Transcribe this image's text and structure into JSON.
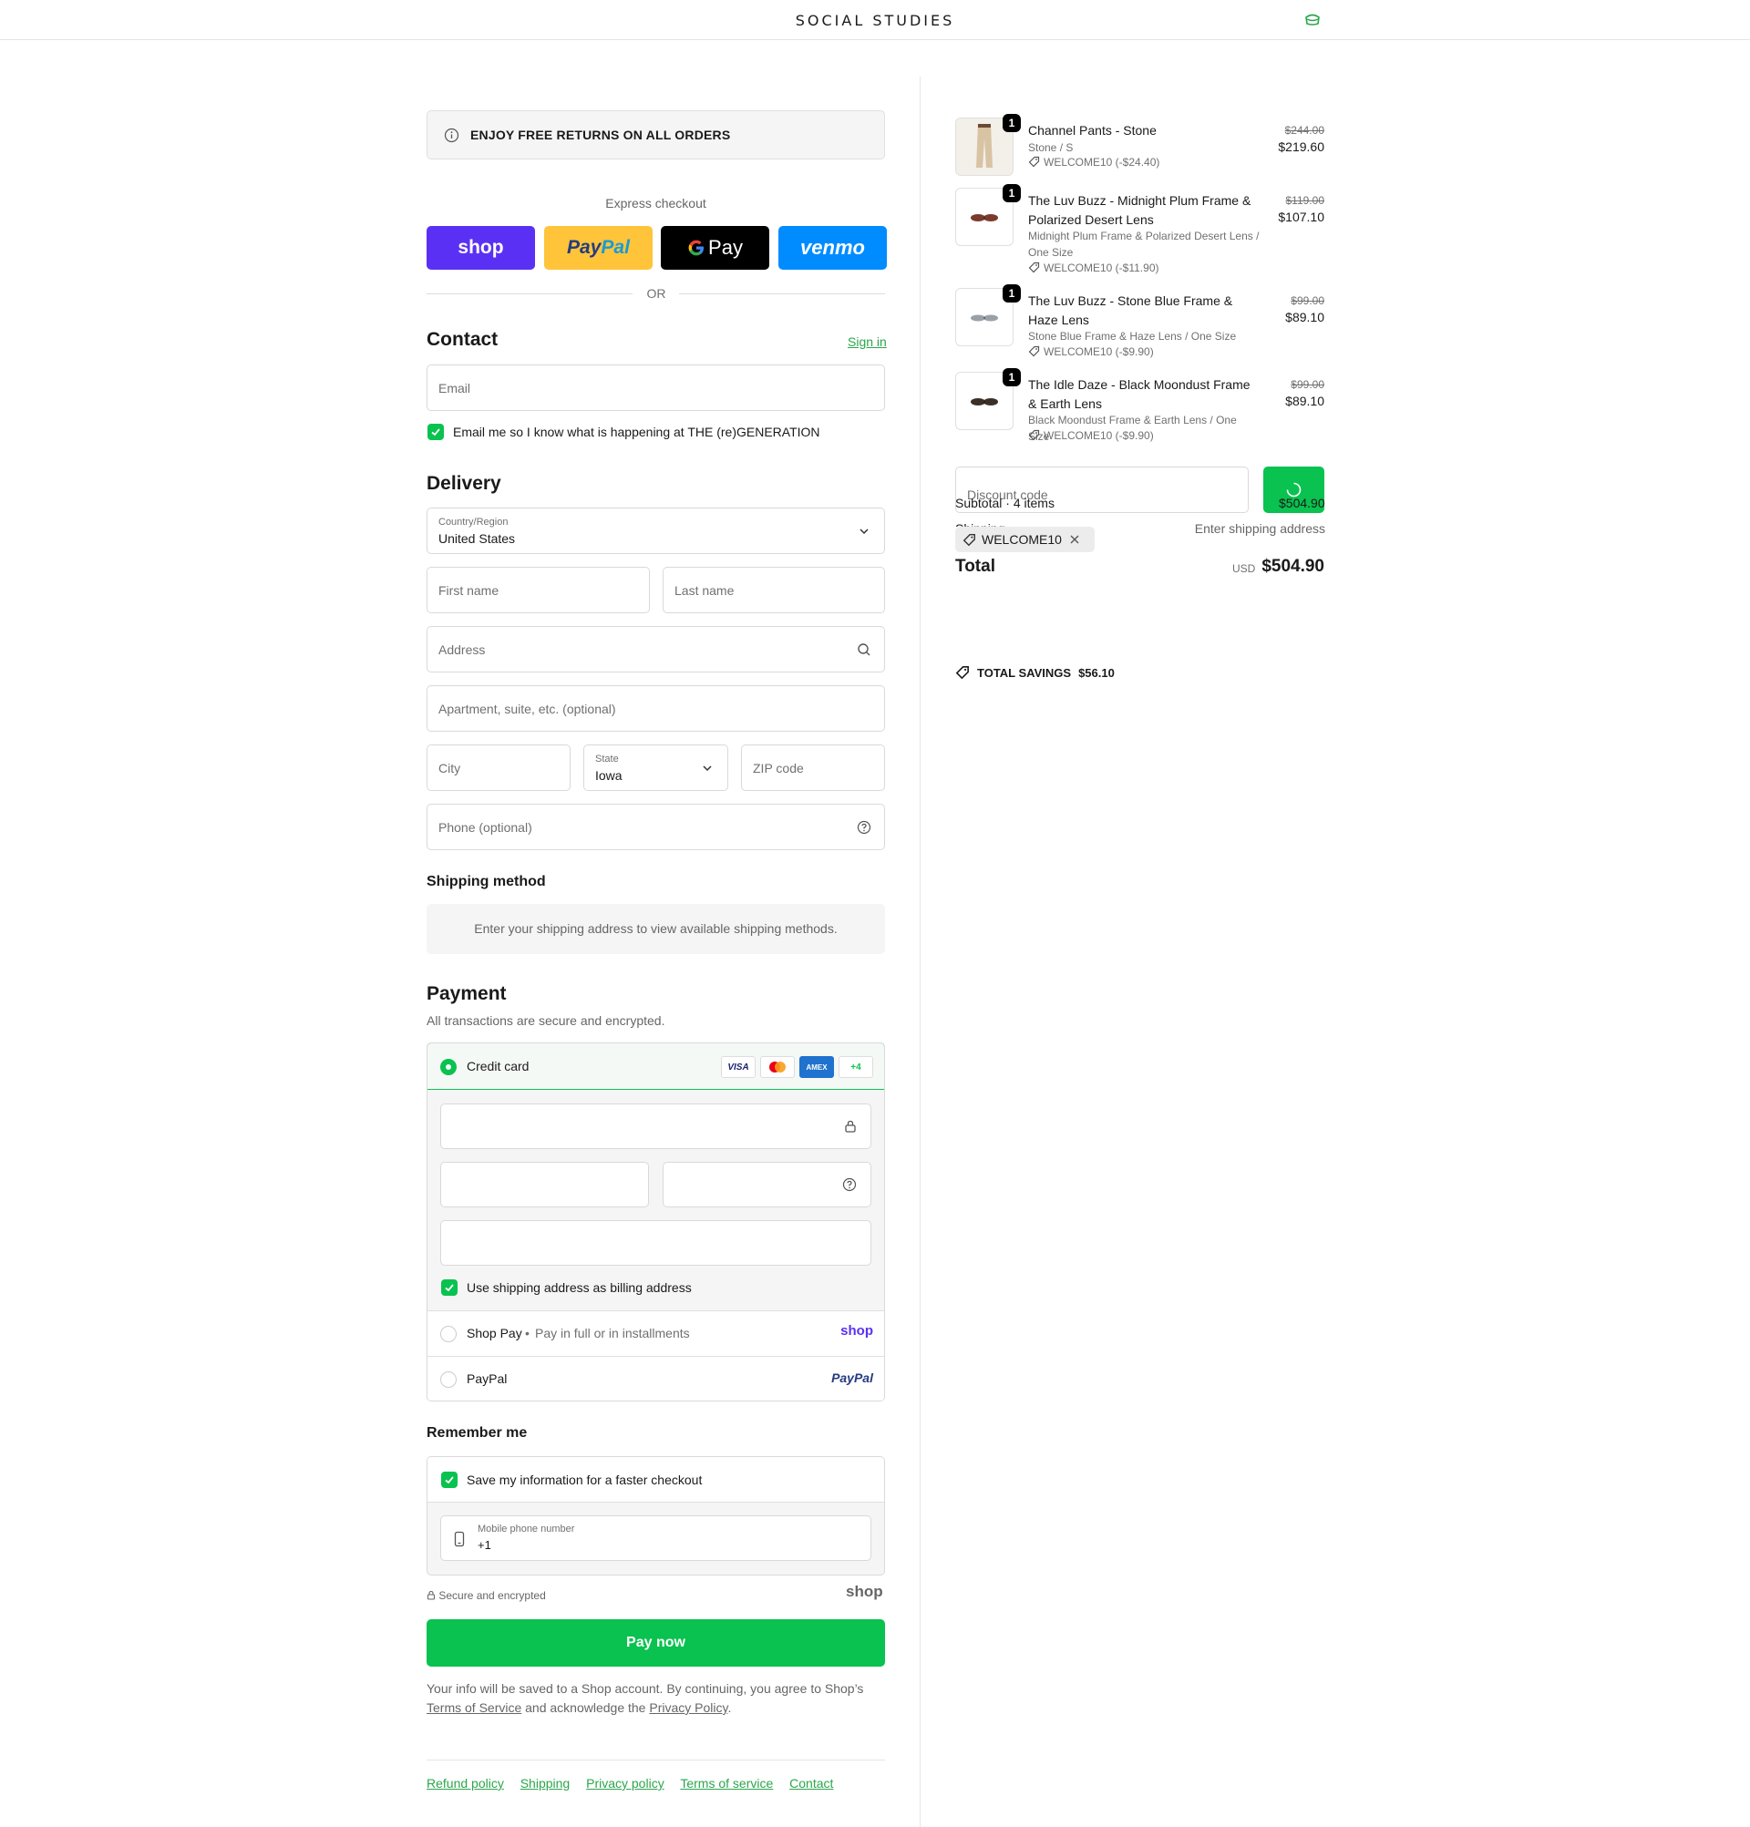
{
  "header": {
    "brand": "SOCIAL STUDIES"
  },
  "banner": {
    "text": "ENJOY FREE RETURNS ON ALL ORDERS"
  },
  "express": {
    "label": "Express checkout",
    "shop": "shop",
    "paypal": "PayPal",
    "gpay": "Pay",
    "venmo": "venmo",
    "or": "OR"
  },
  "contact": {
    "title": "Contact",
    "signin": "Sign in",
    "email_placeholder": "Email",
    "marketing_label": "Email me so I know what is happening at THE (re)GENERATION"
  },
  "delivery": {
    "title": "Delivery",
    "country_label": "Country/Region",
    "country_value": "United States",
    "first_name": "First name",
    "last_name": "Last name",
    "address": "Address",
    "apartment": "Apartment, suite, etc. (optional)",
    "city": "City",
    "state_label": "State",
    "state_value": "Iowa",
    "zip": "ZIP code",
    "phone": "Phone (optional)"
  },
  "shipping": {
    "title": "Shipping method",
    "message": "Enter your shipping address to view available shipping methods."
  },
  "payment": {
    "title": "Payment",
    "subtitle": "All transactions are secure and encrypted.",
    "credit_card": "Credit card",
    "card_logos": [
      "VISA",
      "MC",
      "AMEX",
      "+4"
    ],
    "billing_label": "Use shipping address as billing address",
    "shop_pay": "Shop Pay",
    "shop_pay_sub": "Pay in full or in installments",
    "shop_pay_logo": "shop",
    "paypal": "PayPal",
    "paypal_logo": "PayPal"
  },
  "remember": {
    "title": "Remember me",
    "save_label": "Save my information for a faster checkout",
    "phone_label": "Mobile phone number",
    "phone_value": "+1"
  },
  "checkout": {
    "secure": "Secure and encrypted",
    "shop_logo": "shop",
    "pay_now": "Pay now",
    "legal_1": "Your info will be saved to a Shop account. By continuing, you agree to Shop’s",
    "terms": "Terms of Service",
    "legal_2": "and acknowledge the",
    "privacy": "Privacy Policy",
    "legal_3": "."
  },
  "footer": {
    "links": [
      "Refund policy",
      "Shipping",
      "Privacy policy",
      "Terms of service",
      "Contact"
    ]
  },
  "cart": {
    "items": [
      {
        "qty": "1",
        "name": "Channel Pants - Stone",
        "variant": "Stone / S",
        "discount": "WELCOME10 (-$24.40)",
        "old_price": "$244.00",
        "price": "$219.60"
      },
      {
        "qty": "1",
        "name": "The Luv Buzz - Midnight Plum Frame & Polarized Desert Lens",
        "variant": "Midnight Plum Frame & Polarized Desert Lens / One Size",
        "discount": "WELCOME10 (-$11.90)",
        "old_price": "$119.00",
        "price": "$107.10"
      },
      {
        "qty": "1",
        "name": "The Luv Buzz - Stone Blue Frame & Haze Lens",
        "variant": "Stone Blue Frame & Haze Lens / One Size",
        "discount": "WELCOME10 (-$9.90)",
        "old_price": "$99.00",
        "price": "$89.10"
      },
      {
        "qty": "1",
        "name": "The Idle Daze - Black Moondust Frame & Earth Lens",
        "variant": "Black Moondust Frame & Earth Lens / One Size",
        "discount": "WELCOME10 (-$9.90)",
        "old_price": "$99.00",
        "price": "$89.10"
      }
    ],
    "discount_placeholder": "Discount code",
    "subtotal_label": "Subtotal · 4 items",
    "subtotal_value": "$504.90",
    "shipping_label": "Shipping",
    "shipping_value": "Enter shipping address",
    "applied_code": "WELCOME10",
    "total_label": "Total",
    "currency": "USD",
    "total_value": "$504.90",
    "savings_label": "TOTAL SAVINGS",
    "savings_value": "$56.10"
  },
  "colors": {
    "accent": "#09c24f",
    "link": "#2aa64a",
    "shop": "#5a31f4",
    "paypal": "#ffc439",
    "venmo": "#008cff"
  }
}
